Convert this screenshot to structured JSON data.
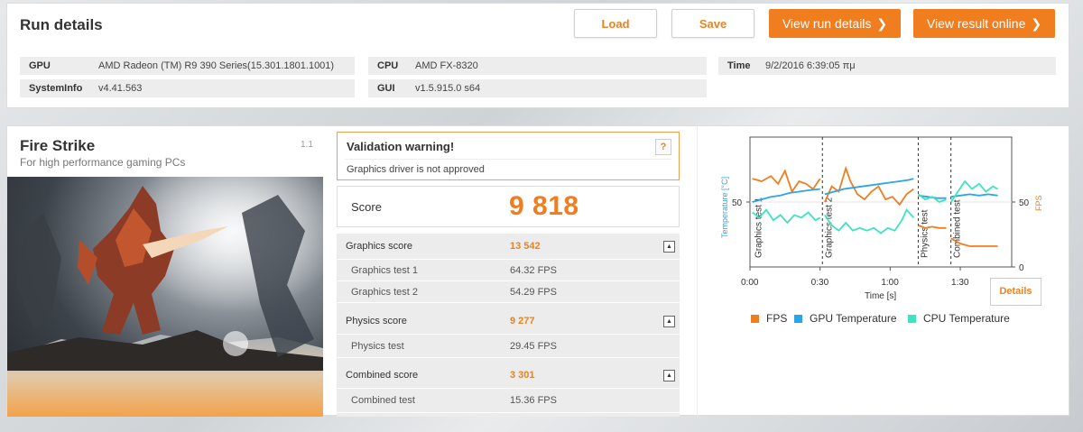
{
  "run_details": {
    "title": "Run details",
    "load_label": "Load",
    "save_label": "Save",
    "view_run_label": "View run details",
    "view_online_label": "View result online",
    "chevron": "❯",
    "gpu_key": "GPU",
    "gpu_value": "AMD Radeon (TM) R9 390 Series(15.301.1801.1001)",
    "sysinfo_key": "SystemInfo",
    "sysinfo_value": "v4.41.563",
    "cpu_key": "CPU",
    "cpu_value": "AMD FX-8320",
    "gui_key": "GUI",
    "gui_value": "v1.5.915.0 s64",
    "time_key": "Time",
    "time_value": "9/2/2016 6:39:05 πμ"
  },
  "benchmark": {
    "title": "Fire Strike",
    "subtitle": "For high performance gaming PCs",
    "version": "1.1"
  },
  "validation": {
    "title": "Validation warning!",
    "message": "Graphics driver is not approved",
    "help": "?"
  },
  "score": {
    "label": "Score",
    "value": "9 818"
  },
  "results": {
    "graphics_label": "Graphics score",
    "graphics_value": "13 542",
    "gt1_label": "Graphics test 1",
    "gt1_value": "64.32 FPS",
    "gt2_label": "Graphics test 2",
    "gt2_value": "54.29 FPS",
    "physics_label": "Physics score",
    "physics_value": "9 277",
    "pt_label": "Physics test",
    "pt_value": "29.45 FPS",
    "combined_label": "Combined score",
    "combined_value": "3 301",
    "ct_label": "Combined test",
    "ct_value": "15.36 FPS"
  },
  "monitor": {
    "details_label": "Details",
    "colors": {
      "fps": "#f07d1e",
      "gpu": "#2aa6e8",
      "cpu": "#3ee3c0"
    }
  },
  "chart_data": {
    "type": "line",
    "xlabel": "Time [s]",
    "ylabel_left": "Temperature [°C]",
    "ylabel_right": "FPS",
    "xticks": [
      "0:00",
      "0:30",
      "1:00",
      "1:30"
    ],
    "x_tick_values": [
      0,
      30,
      60,
      90
    ],
    "xlim": [
      0,
      112
    ],
    "ylim": [
      0,
      100
    ],
    "left_ticks": [
      {
        "value": 50,
        "label": "50"
      }
    ],
    "right_ticks": [
      {
        "value": 0,
        "label": "0"
      },
      {
        "value": 50,
        "label": "50"
      }
    ],
    "sections": [
      {
        "label": "Graphics test 1",
        "x": 1
      },
      {
        "label": "Graphics test 2",
        "x": 31
      },
      {
        "label": "Physics test",
        "x": 72
      },
      {
        "label": "Combined test",
        "x": 86
      }
    ],
    "legend": [
      "FPS",
      "GPU Temperature",
      "CPU Temperature"
    ],
    "series": [
      {
        "name": "FPS",
        "segments": [
          [
            [
              1,
              68
            ],
            [
              5,
              66
            ],
            [
              9,
              70
            ],
            [
              12,
              64
            ],
            [
              15,
              74
            ],
            [
              18,
              58
            ],
            [
              21,
              66
            ],
            [
              24,
              64
            ],
            [
              27,
              60
            ],
            [
              30,
              68
            ]
          ],
          [
            [
              32,
              50
            ],
            [
              35,
              62
            ],
            [
              38,
              58
            ],
            [
              41,
              76
            ],
            [
              43,
              66
            ],
            [
              46,
              56
            ],
            [
              49,
              52
            ],
            [
              52,
              58
            ],
            [
              55,
              62
            ],
            [
              58,
              52
            ],
            [
              61,
              54
            ],
            [
              64,
              48
            ],
            [
              67,
              56
            ],
            [
              70,
              60
            ]
          ],
          [
            [
              72,
              32
            ],
            [
              75,
              30
            ],
            [
              78,
              31
            ],
            [
              81,
              30
            ],
            [
              84,
              30
            ]
          ],
          [
            [
              86,
              22
            ],
            [
              90,
              18
            ],
            [
              94,
              16
            ],
            [
              98,
              16
            ],
            [
              102,
              16
            ],
            [
              106,
              16
            ]
          ]
        ]
      },
      {
        "name": "GPU Temperature",
        "segments": [
          [
            [
              1,
              50
            ],
            [
              5,
              52
            ],
            [
              9,
              54
            ],
            [
              13,
              55
            ],
            [
              17,
              57
            ],
            [
              21,
              58
            ],
            [
              25,
              59
            ],
            [
              30,
              60
            ]
          ],
          [
            [
              32,
              56
            ],
            [
              36,
              58
            ],
            [
              40,
              60
            ],
            [
              44,
              61
            ],
            [
              48,
              62
            ],
            [
              52,
              63
            ],
            [
              56,
              64
            ],
            [
              60,
              65
            ],
            [
              64,
              66
            ],
            [
              68,
              67
            ],
            [
              70,
              68
            ]
          ],
          [
            [
              72,
              55
            ],
            [
              76,
              54
            ],
            [
              80,
              53
            ],
            [
              84,
              53
            ]
          ],
          [
            [
              86,
              54
            ],
            [
              90,
              55
            ],
            [
              94,
              56
            ],
            [
              98,
              55
            ],
            [
              102,
              56
            ],
            [
              106,
              55
            ]
          ]
        ]
      },
      {
        "name": "CPU Temperature",
        "segments": [
          [
            [
              1,
              42
            ],
            [
              4,
              38
            ],
            [
              7,
              44
            ],
            [
              10,
              36
            ],
            [
              13,
              40
            ],
            [
              16,
              34
            ],
            [
              19,
              40
            ],
            [
              22,
              38
            ],
            [
              25,
              42
            ],
            [
              28,
              36
            ],
            [
              30,
              38
            ]
          ],
          [
            [
              32,
              40
            ],
            [
              35,
              32
            ],
            [
              38,
              28
            ],
            [
              41,
              34
            ],
            [
              44,
              28
            ],
            [
              47,
              30
            ],
            [
              50,
              28
            ],
            [
              53,
              30
            ],
            [
              56,
              26
            ],
            [
              59,
              30
            ],
            [
              62,
              28
            ],
            [
              65,
              36
            ],
            [
              67,
              44
            ],
            [
              70,
              38
            ]
          ],
          [
            [
              72,
              56
            ],
            [
              75,
              52
            ],
            [
              78,
              54
            ],
            [
              81,
              50
            ],
            [
              84,
              52
            ]
          ],
          [
            [
              86,
              50
            ],
            [
              89,
              58
            ],
            [
              92,
              66
            ],
            [
              95,
              60
            ],
            [
              98,
              64
            ],
            [
              101,
              58
            ],
            [
              104,
              62
            ],
            [
              106,
              60
            ]
          ]
        ]
      }
    ]
  }
}
